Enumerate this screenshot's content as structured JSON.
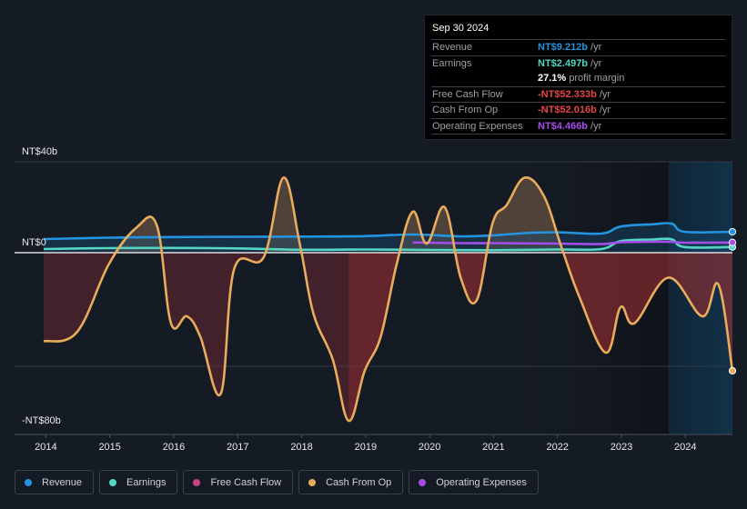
{
  "tooltip": {
    "date": "Sep 30 2024",
    "rows": [
      {
        "label": "Revenue",
        "value": "NT$9.212b",
        "unit": "/yr",
        "color": "#2394df"
      },
      {
        "label": "Earnings",
        "value": "NT$2.497b",
        "unit": "/yr",
        "color": "#54d6c4"
      },
      {
        "label": "",
        "value": "27.1%",
        "unit": "profit margin",
        "color": "#ffffff"
      },
      {
        "label": "Free Cash Flow",
        "value": "-NT$52.333b",
        "unit": "/yr",
        "color": "#e64545"
      },
      {
        "label": "Cash From Op",
        "value": "-NT$52.016b",
        "unit": "/yr",
        "color": "#e64545"
      },
      {
        "label": "Operating Expenses",
        "value": "NT$4.466b",
        "unit": "/yr",
        "color": "#a44ee8"
      }
    ]
  },
  "legend": [
    {
      "label": "Revenue",
      "color": "#2394df"
    },
    {
      "label": "Earnings",
      "color": "#54d6c4"
    },
    {
      "label": "Free Cash Flow",
      "color": "#c4457f"
    },
    {
      "label": "Cash From Op",
      "color": "#e8ac5c"
    },
    {
      "label": "Operating Expenses",
      "color": "#a44ee8"
    }
  ],
  "chart_data": {
    "type": "line",
    "title": "",
    "xlabel": "",
    "ylabel": "",
    "ylim": [
      -80,
      40
    ],
    "xlim": [
      2013.98,
      2024.75
    ],
    "y_tick_labels": [
      {
        "value": 40,
        "label": "NT$40b"
      },
      {
        "value": 0,
        "label": "NT$0"
      },
      {
        "value": -80,
        "label": "-NT$80b"
      }
    ],
    "gridlines": [
      40,
      -50
    ],
    "x_ticks": [
      2014,
      2015,
      2016,
      2017,
      2018,
      2019,
      2020,
      2021,
      2022,
      2023,
      2024
    ],
    "forecast_start": 2023.75,
    "units": "NT$ billions",
    "series": [
      {
        "name": "Revenue",
        "color": "#2394df",
        "x": [
          2013.98,
          2015,
          2016,
          2017,
          2018,
          2019,
          2019.75,
          2020.5,
          2021,
          2021.5,
          2022,
          2022.7,
          2023,
          2023.5,
          2023.8,
          2024,
          2024.75
        ],
        "y": [
          6.0,
          6.6,
          6.9,
          7.0,
          7.1,
          7.3,
          8.0,
          7.2,
          7.6,
          8.6,
          9.0,
          8.4,
          11.5,
          12.5,
          12.8,
          9.2,
          9.2
        ]
      },
      {
        "name": "Earnings",
        "color": "#54d6c4",
        "x": [
          2013.98,
          2015,
          2016,
          2017,
          2018,
          2019,
          2020,
          2021,
          2022,
          2022.7,
          2023,
          2023.5,
          2023.8,
          2024,
          2024.75
        ],
        "y": [
          1.6,
          2.0,
          2.1,
          1.9,
          1.3,
          1.4,
          1.2,
          1.1,
          1.4,
          1.6,
          5.1,
          5.8,
          5.9,
          2.5,
          2.5
        ]
      },
      {
        "name": "Operating Expenses",
        "color": "#a44ee8",
        "x": [
          2019.75,
          2020.5,
          2021,
          2021.5,
          2022,
          2022.7,
          2023,
          2023.5,
          2023.8,
          2024,
          2024.75
        ],
        "y": [
          4.5,
          4.2,
          4.2,
          4.1,
          4.0,
          3.8,
          4.6,
          4.8,
          4.8,
          4.4,
          4.5
        ]
      },
      {
        "name": "Cash From Op",
        "color": "#e8ac5c",
        "x": [
          2013.98,
          2014.5,
          2015.0,
          2015.43,
          2015.75,
          2015.97,
          2016.22,
          2016.43,
          2016.75,
          2016.96,
          2017.42,
          2017.73,
          2017.99,
          2018.2,
          2018.5,
          2018.75,
          2019.0,
          2019.25,
          2019.5,
          2019.75,
          2019.97,
          2020.25,
          2020.5,
          2020.75,
          2021.0,
          2021.22,
          2021.5,
          2021.8,
          2022.07,
          2022.35,
          2022.77,
          2023.0,
          2023.22,
          2023.75,
          2024.28,
          2024.53,
          2024.75
        ],
        "y": [
          -39,
          -35,
          -5,
          11,
          12,
          -31,
          -28,
          -37,
          -62,
          -7,
          -2,
          33,
          3,
          -27,
          -47,
          -74,
          -52,
          -37,
          -5,
          18,
          4,
          20,
          -11,
          -21,
          13,
          21,
          33,
          25,
          3,
          -19,
          -44,
          -24,
          -31,
          -11,
          -28,
          -14,
          -52
        ]
      },
      {
        "name": "Free Cash Flow",
        "color": "#c4457f",
        "note": "Nearly identical to Cash From Op; drawn as area below zero",
        "x": [
          2013.98,
          2018.75,
          2024.75
        ],
        "y": [
          -39,
          -74,
          -52.3
        ]
      }
    ],
    "end_values": {
      "Revenue": 9.212,
      "Earnings": 2.497,
      "Free Cash Flow": -52.333,
      "Cash From Op": -52.016,
      "Operating Expenses": 4.466
    }
  }
}
